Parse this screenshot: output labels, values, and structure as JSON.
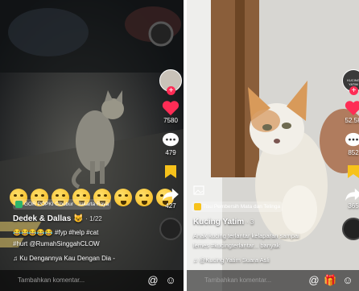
{
  "left_video": {
    "poi_label": "GOR POPKI Cibubur · Jakarta Raya",
    "author": "Dedek & Dallas",
    "author_badge": "😺",
    "time_ago": "· 1/22",
    "caption_line1": "😂😂😂😂😂 #fyp #help #cat",
    "caption_line2": "#hurt @RumahSinggahCLOW",
    "music": "♫ Ku Dengannya Kau Dengan Dia -",
    "likes": "7580",
    "comments": "479",
    "shares": "427",
    "comment_placeholder": "Tambahkan komentar...",
    "emoji_count": 8
  },
  "right_video": {
    "poi_label": "Tisu Pembersih Mata dan Telinga",
    "author": "Kucing Yatim",
    "time_ago": "· 3",
    "caption_line1": "Anak kucing terlantar kelaparan sampai",
    "caption_line2": "lemes #kucingterlantar... banyak",
    "music": "♫ @Kucing Yatim Suara Asli",
    "likes": "52.5K",
    "comments": "852",
    "shares": "365",
    "avatar_label": "KUCING YATIM",
    "comment_placeholder": "Tambahkan komentar..."
  },
  "colors": {
    "like_red": "#fe2c55",
    "poi_green": "#2fb56b",
    "bookmark_yellow": "#f7c21b"
  },
  "icons": [
    "heart-icon",
    "comment-icon",
    "bookmark-icon",
    "share-icon",
    "at-icon",
    "emoji-icon",
    "gift-icon",
    "music-note-icon",
    "location-pin-icon"
  ]
}
